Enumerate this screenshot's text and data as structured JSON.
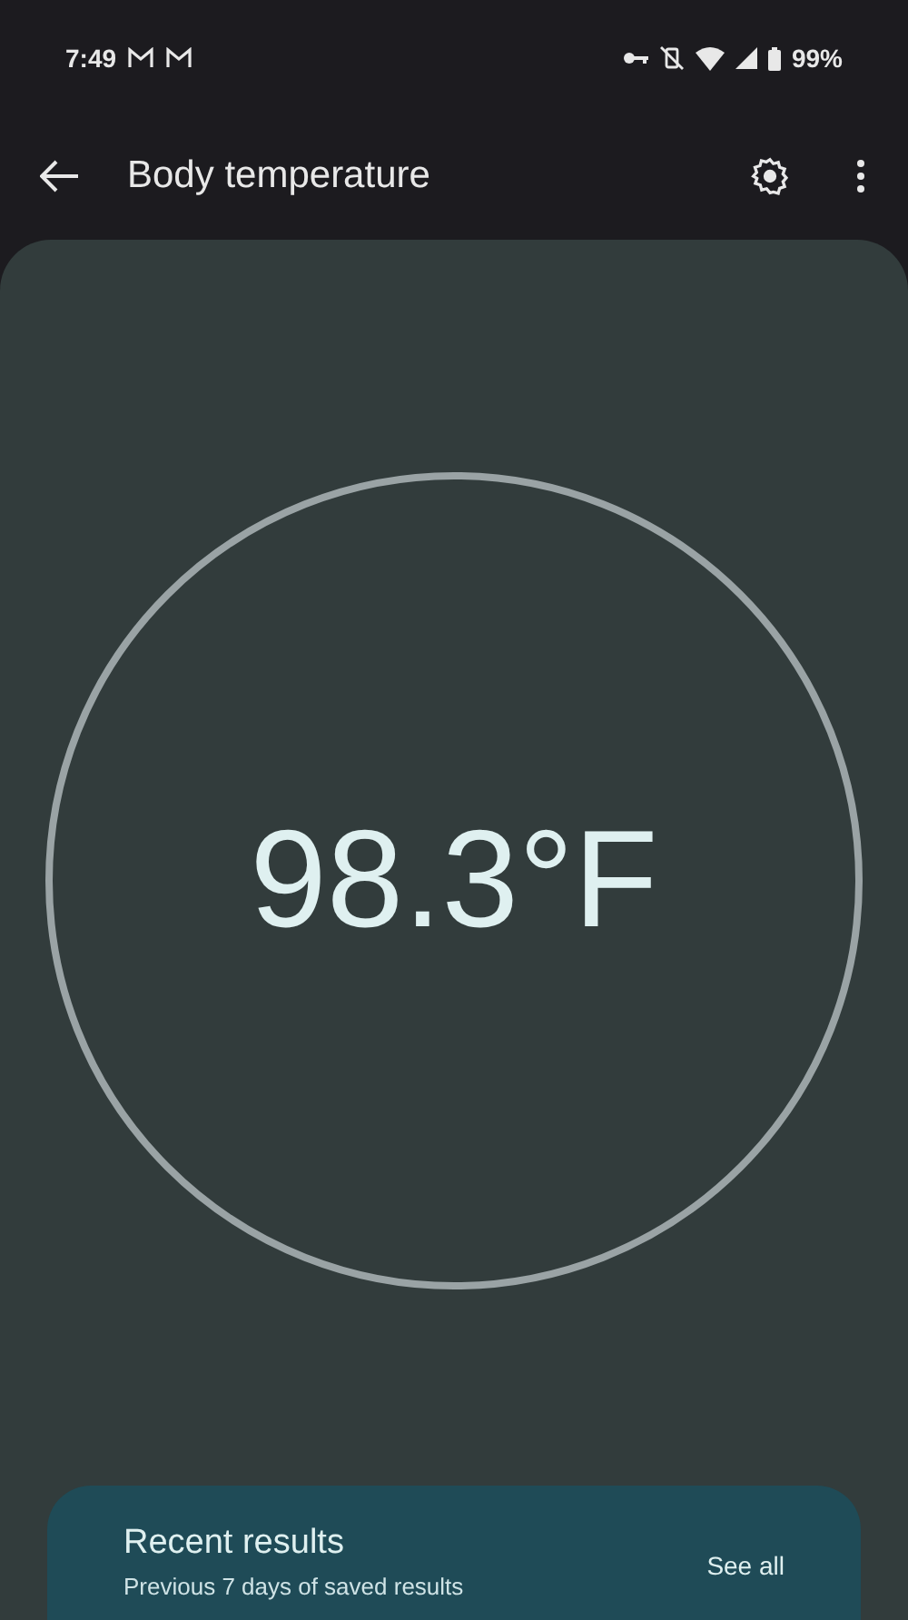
{
  "status_bar": {
    "time": "7:49",
    "battery": "99%"
  },
  "toolbar": {
    "title": "Body temperature"
  },
  "reading": {
    "value": "98.3°F"
  },
  "recent_results": {
    "title": "Recent results",
    "subtitle": "Previous 7 days of saved results",
    "action": "See all"
  }
}
